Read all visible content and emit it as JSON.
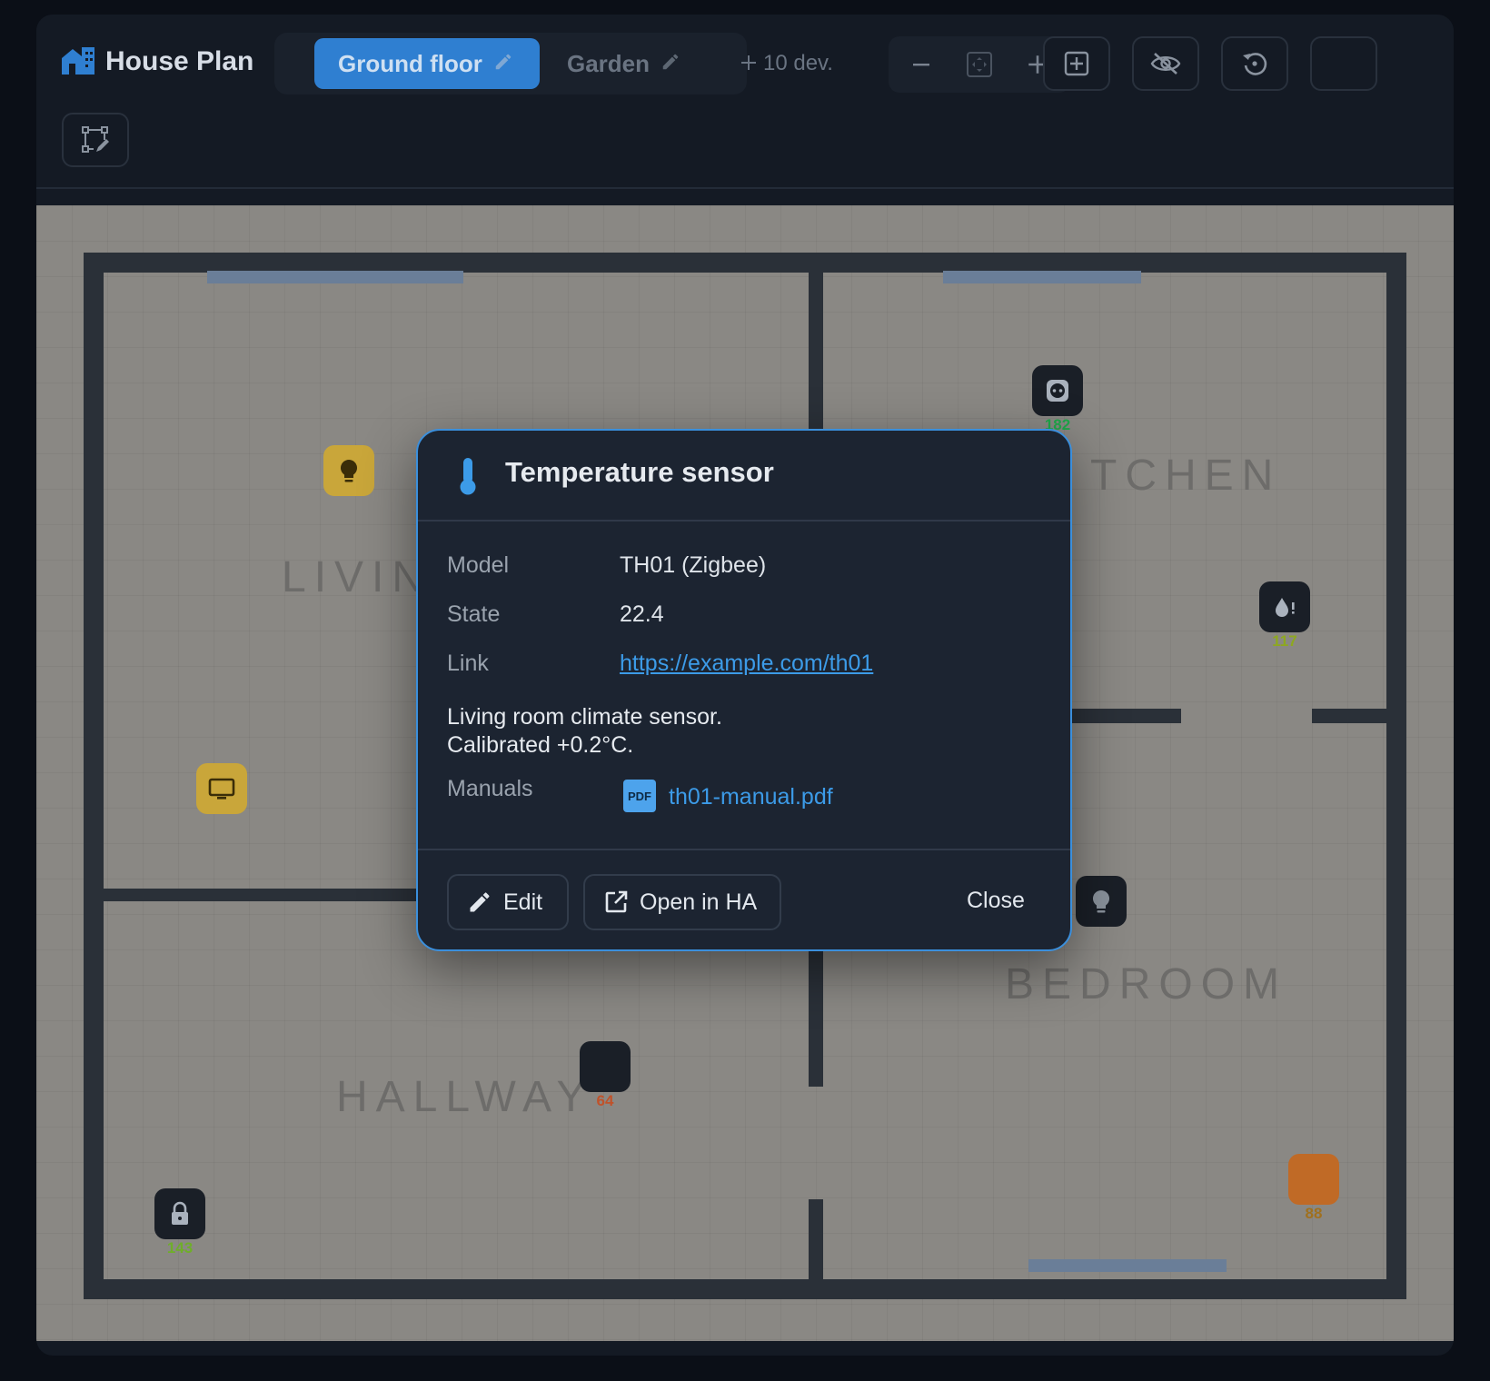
{
  "app": {
    "title": "House Plan",
    "device_count": "10 dev."
  },
  "tabs": [
    {
      "label": "Ground floor",
      "active": true
    },
    {
      "label": "Garden",
      "active": false
    }
  ],
  "toolbar": {
    "zoom_out_icon": "minus-icon",
    "fit_icon": "fit-screen-icon",
    "zoom_in_icon": "plus-icon",
    "add_icon": "add-box-icon",
    "visibility_icon": "eye-off-icon",
    "reset_icon": "reset-icon",
    "edit_icon": "vector-edit-icon"
  },
  "rooms": {
    "living": "LIVIN",
    "kitchen": "TCHEN",
    "bedroom": "BEDROOM",
    "hallway": "HALLWAY"
  },
  "devices": [
    {
      "icon": "socket-icon",
      "value": "182",
      "value_color": "#1fa84a",
      "style": "dark"
    },
    {
      "icon": "water-alert-icon",
      "value": "117",
      "value_color": "#8da81f",
      "style": "dark"
    },
    {
      "icon": "lightbulb-icon",
      "value": "",
      "style": "yellow"
    },
    {
      "icon": "tv-icon",
      "value": "",
      "style": "yellow"
    },
    {
      "icon": "lightbulb-icon",
      "value": "",
      "style": "dark"
    },
    {
      "icon": "blank-device-icon",
      "value": "64",
      "value_color": "#c0522a",
      "style": "dark"
    },
    {
      "icon": "lock-icon",
      "value": "143",
      "value_color": "#6fae2a",
      "style": "dark"
    },
    {
      "icon": "blank-device-icon",
      "value": "88",
      "value_color": "#a0701e",
      "style": "orange"
    }
  ],
  "dialog": {
    "title": "Temperature sensor",
    "icon": "thermometer-icon",
    "model_label": "Model",
    "model_value": "TH01 (Zigbee)",
    "state_label": "State",
    "state_value": "22.4",
    "link_label": "Link",
    "link_value": "https://example.com/th01",
    "description_line1": "Living room climate sensor.",
    "description_line2": "Calibrated +0.2°C.",
    "manuals_label": "Manuals",
    "manual_icon_text": "PDF",
    "manual_file": "th01-manual.pdf",
    "edit_label": "Edit",
    "open_label": "Open in HA",
    "close_label": "Close"
  }
}
